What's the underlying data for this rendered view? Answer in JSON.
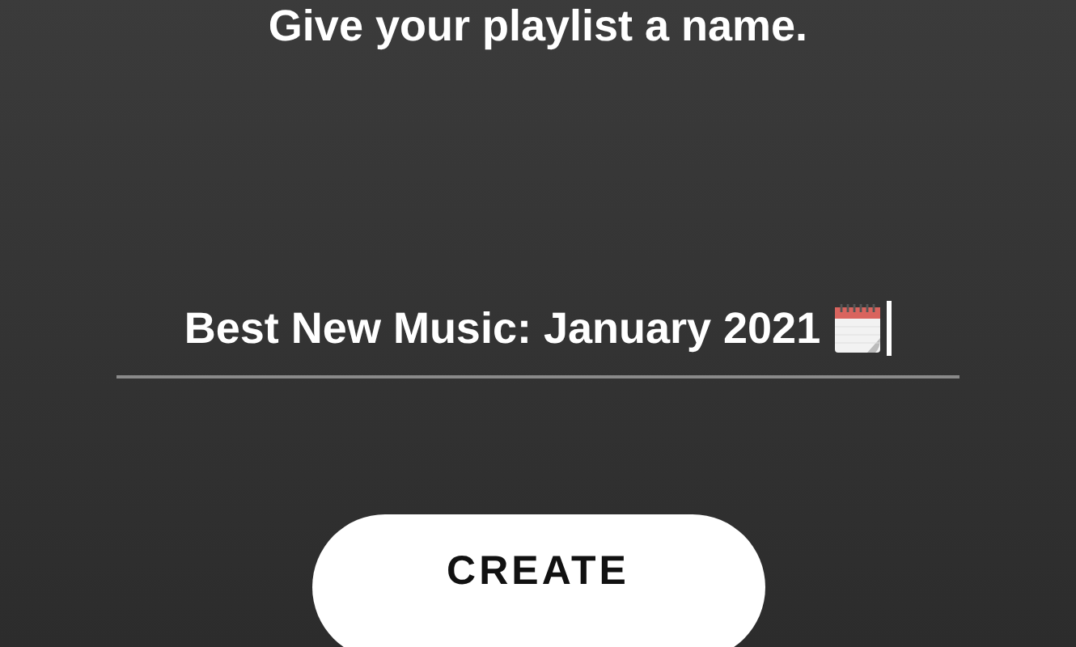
{
  "heading": "Give your playlist a name.",
  "name_field": {
    "value": "Best New Music: January 2021",
    "focused": true
  },
  "buttons": [
    "CREATE"
  ]
}
